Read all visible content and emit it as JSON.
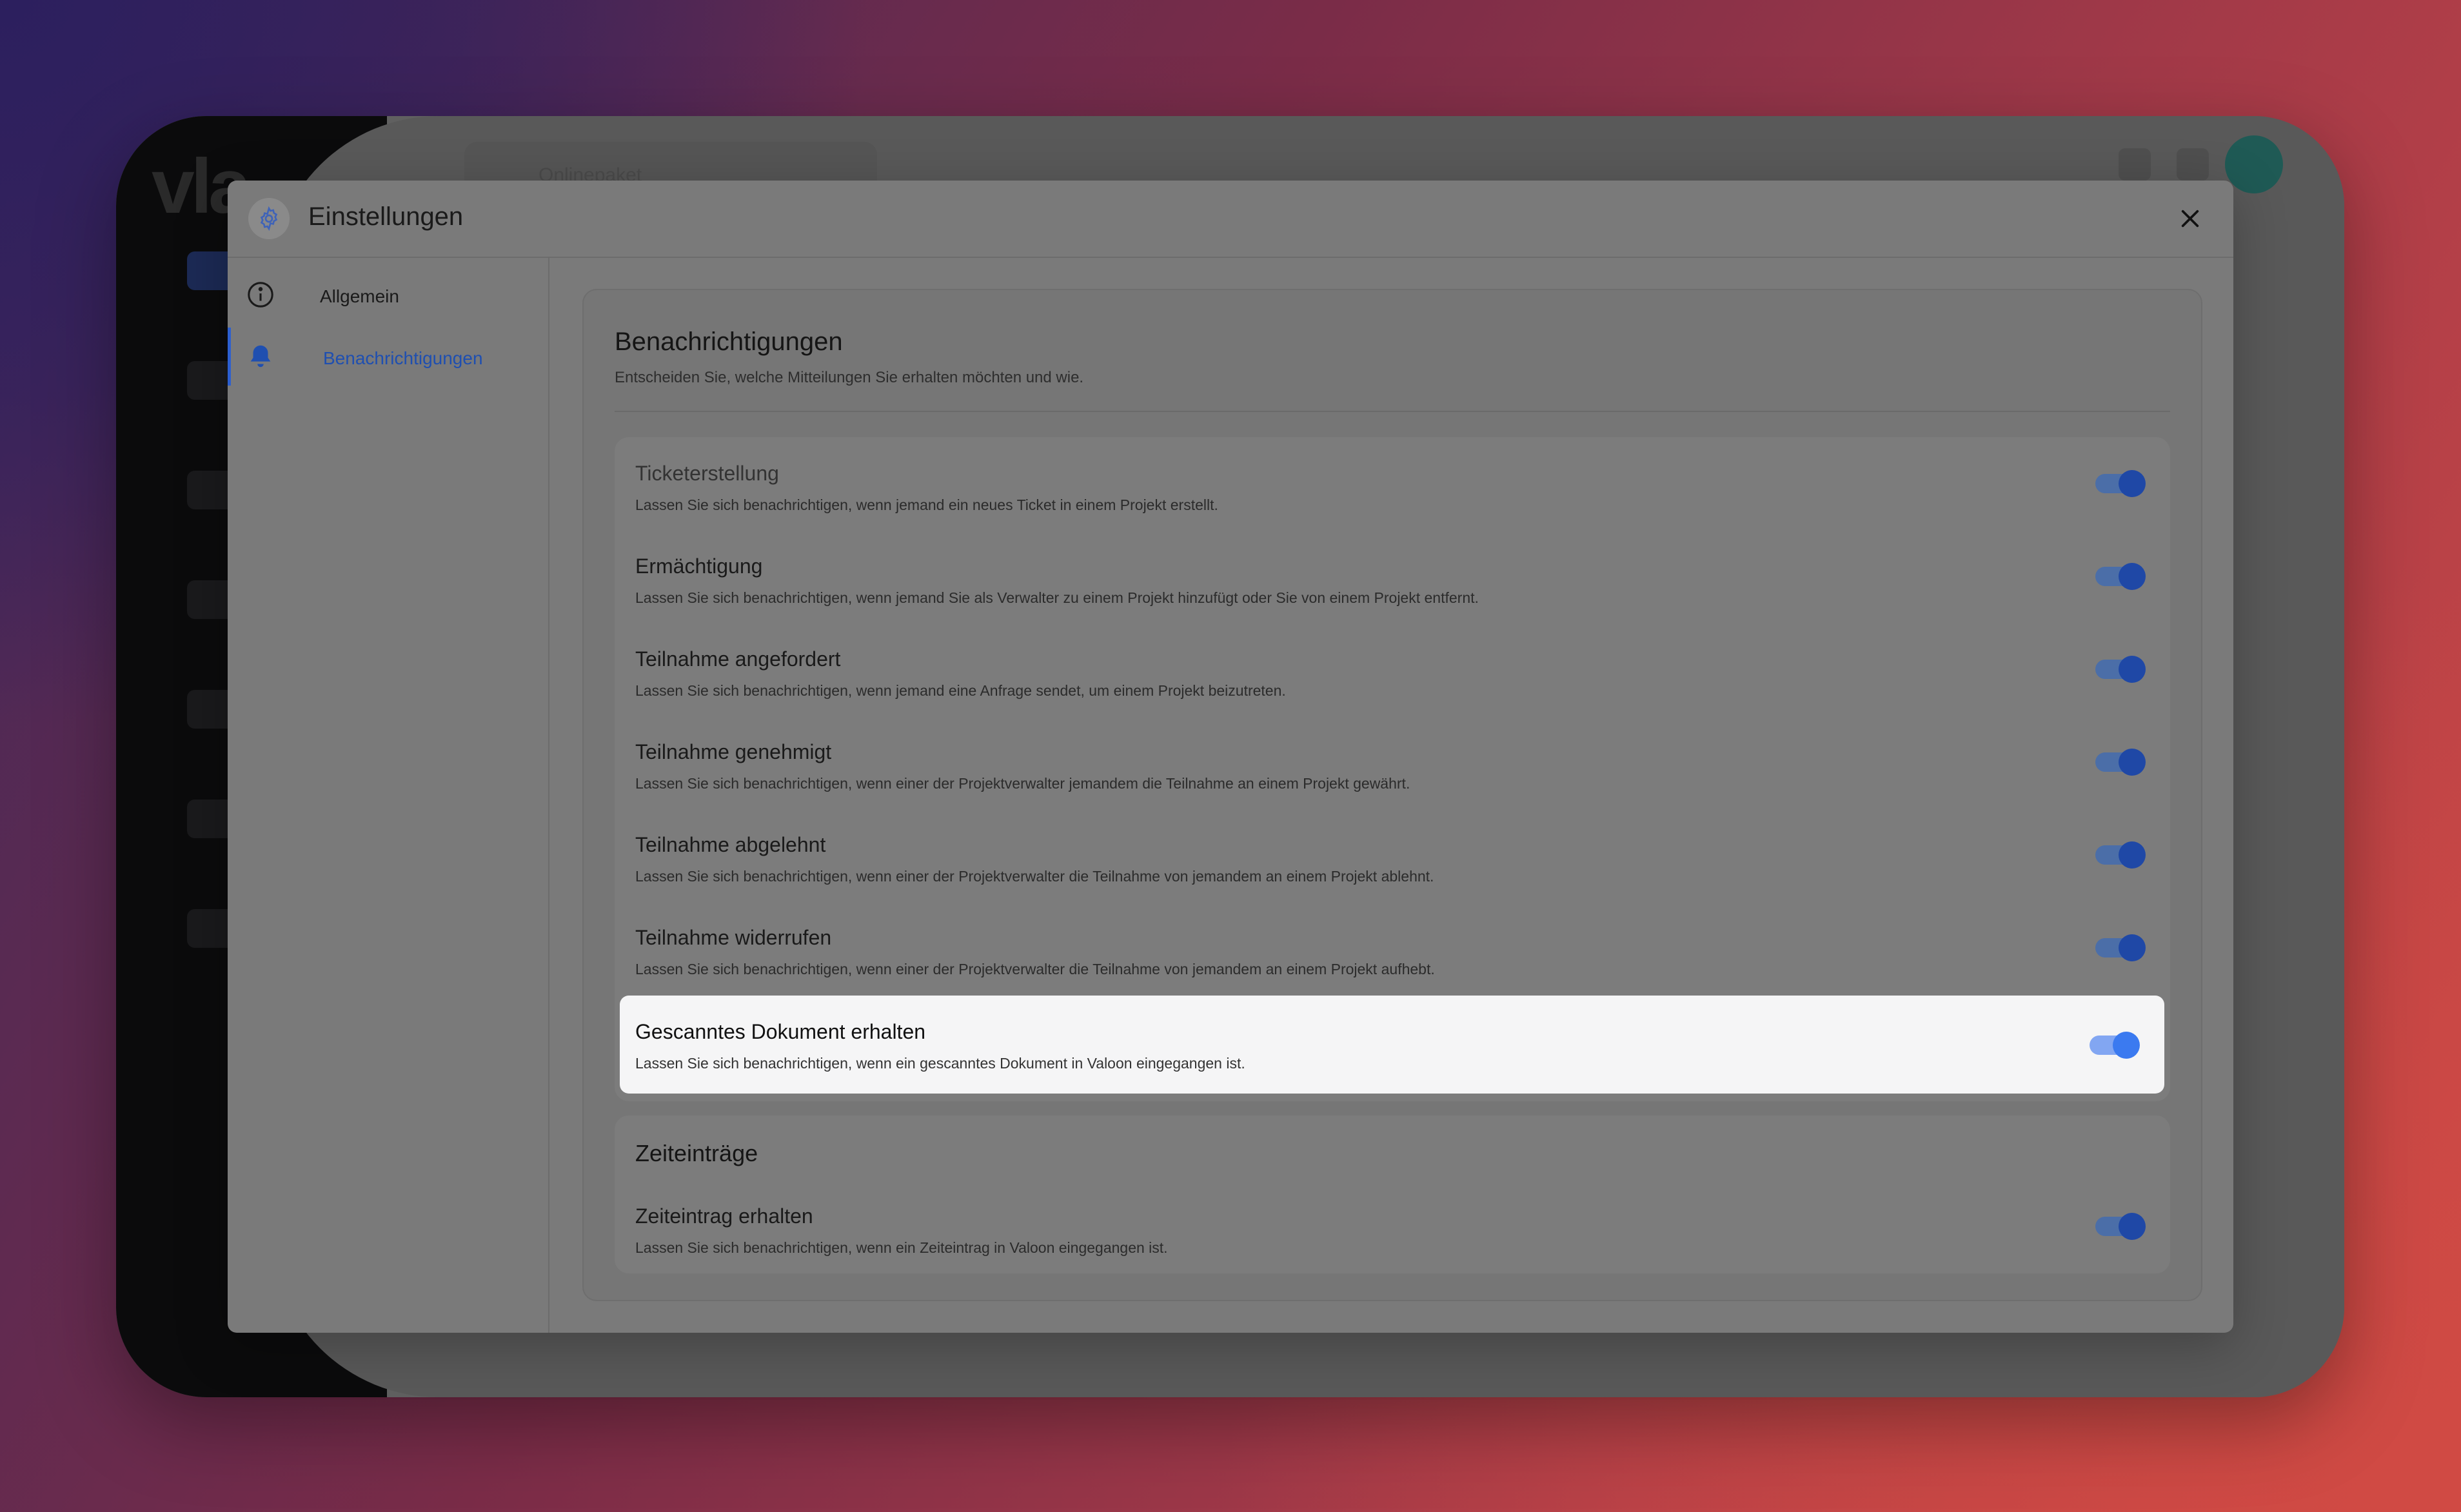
{
  "background_app": {
    "logo": "vla",
    "search_text": "Onlinepaket"
  },
  "modal": {
    "title": "Einstellungen",
    "close_icon": "close-icon"
  },
  "nav": {
    "items": [
      {
        "label": "Allgemein",
        "icon": "info-icon",
        "active": false
      },
      {
        "label": "Benachrichtigungen",
        "icon": "bell-icon",
        "active": true
      }
    ]
  },
  "notifications": {
    "title": "Benachrichtigungen",
    "subtitle": "Entscheiden Sie, welche Mitteilungen Sie erhalten möchten und wie.",
    "items": [
      {
        "title": "Ticketerstellung",
        "description": "Lassen Sie sich benachrichtigen, wenn jemand ein neues Ticket in einem Projekt erstellt.",
        "enabled": true
      },
      {
        "title": "Ermächtigung",
        "description": "Lassen Sie sich benachrichtigen, wenn jemand Sie als Verwalter zu einem Projekt hinzufügt oder Sie von einem Projekt entfernt.",
        "enabled": true
      },
      {
        "title": "Teilnahme angefordert",
        "description": "Lassen Sie sich benachrichtigen, wenn jemand eine Anfrage sendet, um einem Projekt beizutreten.",
        "enabled": true
      },
      {
        "title": "Teilnahme genehmigt",
        "description": "Lassen Sie sich benachrichtigen, wenn einer der Projektverwalter jemandem die Teilnahme an einem Projekt gewährt.",
        "enabled": true
      },
      {
        "title": "Teilnahme abgelehnt",
        "description": "Lassen Sie sich benachrichtigen, wenn einer der Projektverwalter die Teilnahme von jemandem an einem Projekt ablehnt.",
        "enabled": true
      },
      {
        "title": "Teilnahme widerrufen",
        "description": "Lassen Sie sich benachrichtigen, wenn einer der Projektverwalter die Teilnahme von jemandem an einem Projekt aufhebt.",
        "enabled": true
      },
      {
        "title": "Gescanntes Dokument erhalten",
        "description": "Lassen Sie sich benachrichtigen, wenn ein gescanntes Dokument in Valoon eingegangen ist.",
        "enabled": true
      }
    ]
  },
  "time_entries": {
    "title": "Zeiteinträge",
    "items": [
      {
        "title": "Zeiteintrag erhalten",
        "description": "Lassen Sie sich benachrichtigen, wenn ein Zeiteintrag in Valoon eingegangen ist.",
        "enabled": true
      }
    ]
  },
  "colors": {
    "accent": "#3b7af0",
    "active_nav": "#1f4fb0",
    "toggle_on": "#1f48a6"
  }
}
